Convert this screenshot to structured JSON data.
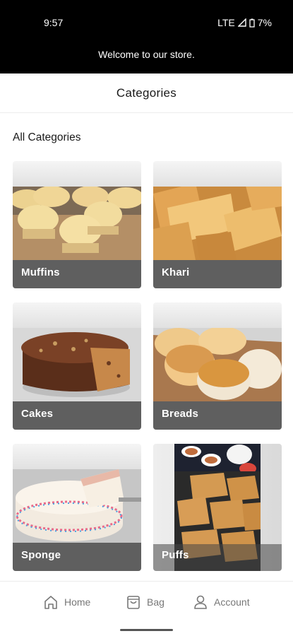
{
  "status_bar": {
    "time": "9:57",
    "network": "LTE",
    "battery": "7%"
  },
  "banner": {
    "text": "Welcome to our store."
  },
  "header": {
    "title": "Categories"
  },
  "section": {
    "title": "All Categories"
  },
  "categories": [
    {
      "label": "Muffins"
    },
    {
      "label": "Khari"
    },
    {
      "label": "Cakes"
    },
    {
      "label": "Breads"
    },
    {
      "label": "Sponge"
    },
    {
      "label": "Puffs"
    }
  ],
  "bottom_nav": {
    "home": {
      "label": "Home",
      "icon": "home-icon"
    },
    "bag": {
      "label": "Bag",
      "icon": "bag-icon"
    },
    "account": {
      "label": "Account",
      "icon": "account-icon"
    }
  }
}
